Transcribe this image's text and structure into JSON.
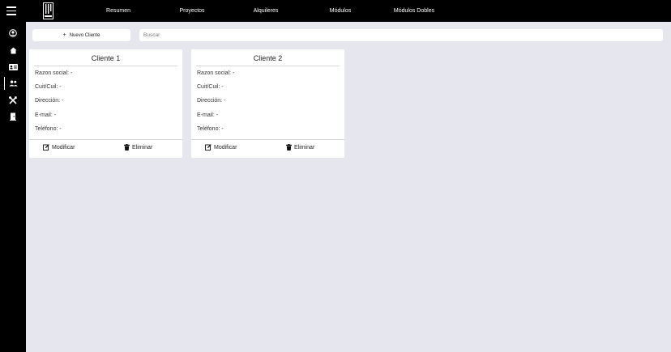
{
  "topbar": {
    "nav": [
      {
        "label": "Resumen"
      },
      {
        "label": "Proyectos"
      },
      {
        "label": "Alquileres"
      },
      {
        "label": "Módulos"
      },
      {
        "label": "Módulos Dobles"
      }
    ]
  },
  "sidebar": {
    "items": [
      {
        "icon": "user-circle-icon"
      },
      {
        "icon": "home-icon"
      },
      {
        "icon": "id-card-icon"
      },
      {
        "icon": "users-icon",
        "active": true
      },
      {
        "icon": "tools-icon"
      },
      {
        "icon": "door-icon"
      }
    ]
  },
  "toolbar": {
    "new_label": "Nuevo Cliente",
    "search_placeholder": "Buscar"
  },
  "clients": [
    {
      "title": "Cliente 1",
      "fields": [
        "Razon social: -",
        "Cuit/Cuil: -",
        "Dirección: -",
        "E-mail: -",
        "Teléfono: -"
      ],
      "edit_label": "Modificar",
      "delete_label": "Eliminar"
    },
    {
      "title": "Cliente 2",
      "fields": [
        "Razon social: -",
        "Cuit/Cuil: -",
        "Dirección: -",
        "E-mail: -",
        "Teléfono: -"
      ],
      "edit_label": "Modificar",
      "delete_label": "Eliminar"
    }
  ],
  "colors": {
    "bar": "#000000",
    "background": "#e6e6ef",
    "card": "#ffffff"
  }
}
